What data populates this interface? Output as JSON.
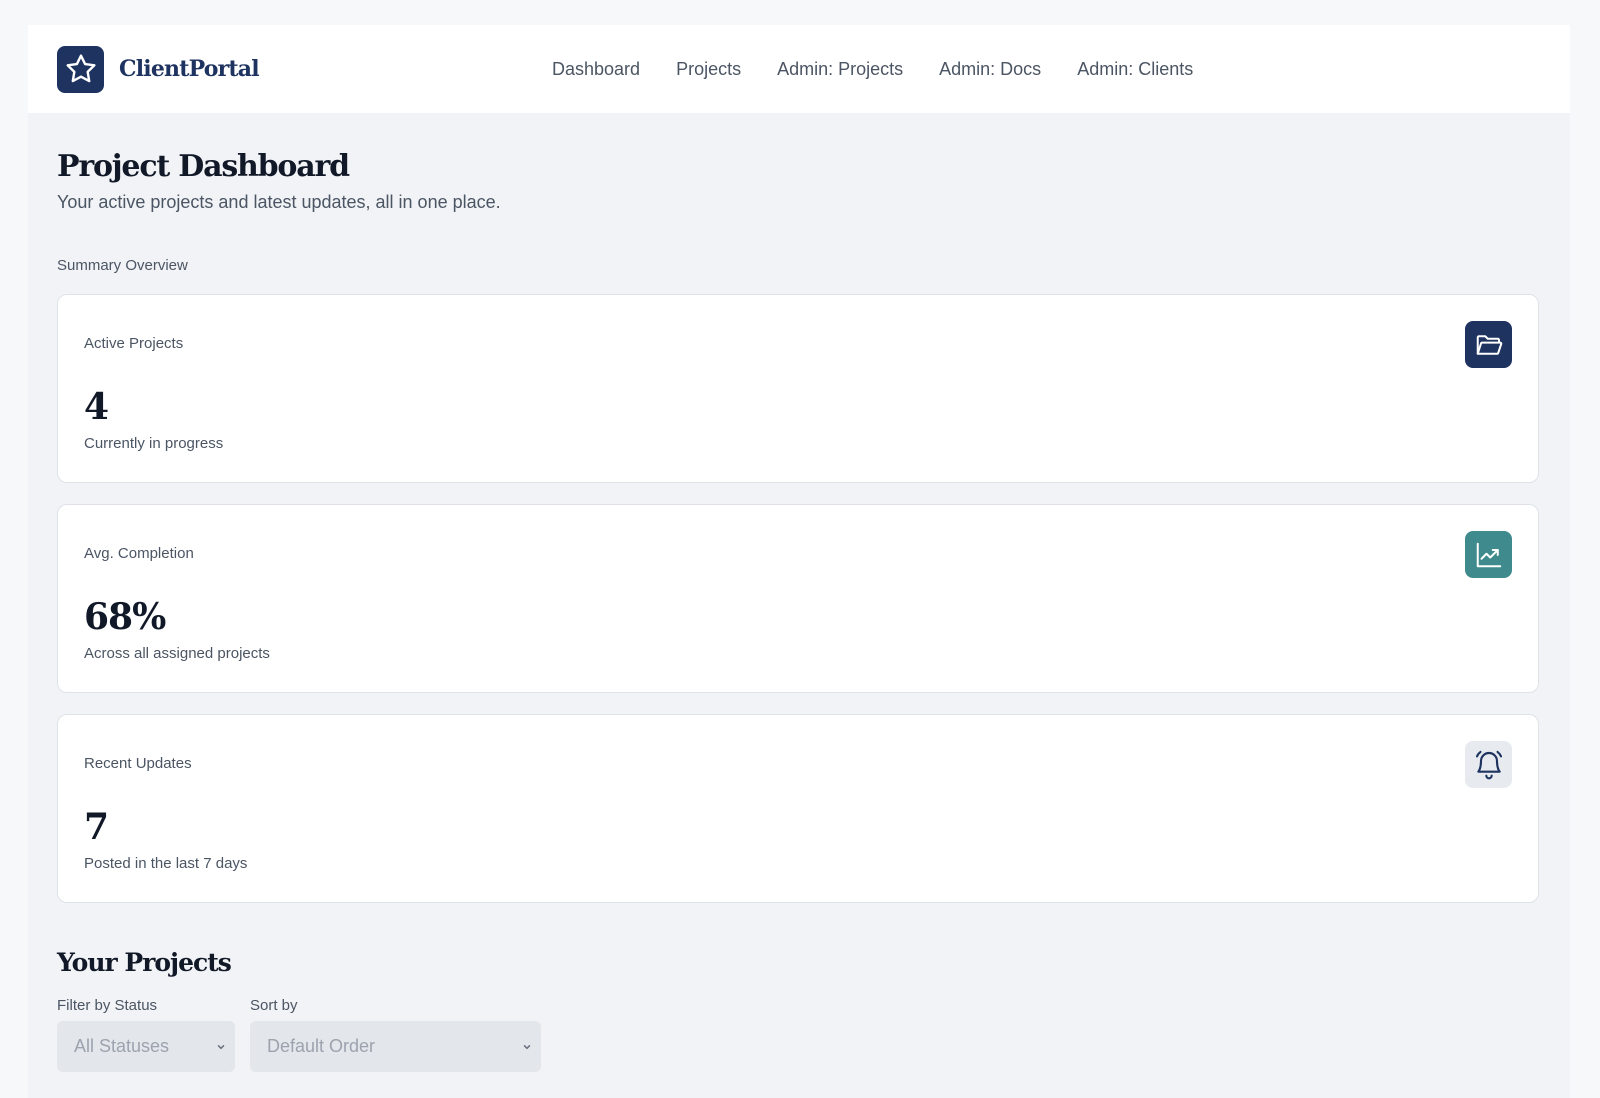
{
  "brand": {
    "name": "ClientPortal",
    "logo_icon": "star-icon"
  },
  "nav": {
    "items": [
      {
        "label": "Dashboard"
      },
      {
        "label": "Projects"
      },
      {
        "label": "Admin: Projects"
      },
      {
        "label": "Admin: Docs"
      },
      {
        "label": "Admin: Clients"
      }
    ]
  },
  "page": {
    "title": "Project Dashboard",
    "subtitle": "Your active projects and latest updates, all in one place."
  },
  "summary": {
    "section_label": "Summary Overview",
    "cards": [
      {
        "label": "Active Projects",
        "value": "4",
        "note": "Currently in progress",
        "icon": "folder-icon",
        "icon_bg": "#1e3360"
      },
      {
        "label": "Avg. Completion",
        "value": "68%",
        "note": "Across all assigned projects",
        "icon": "trend-chart-icon",
        "icon_bg": "#3f8a8c"
      },
      {
        "label": "Recent Updates",
        "value": "7",
        "note": "Posted in the last 7 days",
        "icon": "bell-icon",
        "icon_bg": "#e7eaee"
      }
    ]
  },
  "projects": {
    "title": "Your Projects",
    "filter_status": {
      "label": "Filter by Status",
      "selected": "All Statuses"
    },
    "sort_by": {
      "label": "Sort by",
      "selected": "Default Order"
    }
  },
  "colors": {
    "brand_navy": "#1e3360",
    "accent_teal": "#3f8a8c",
    "page_bg": "#f1f3f6"
  }
}
